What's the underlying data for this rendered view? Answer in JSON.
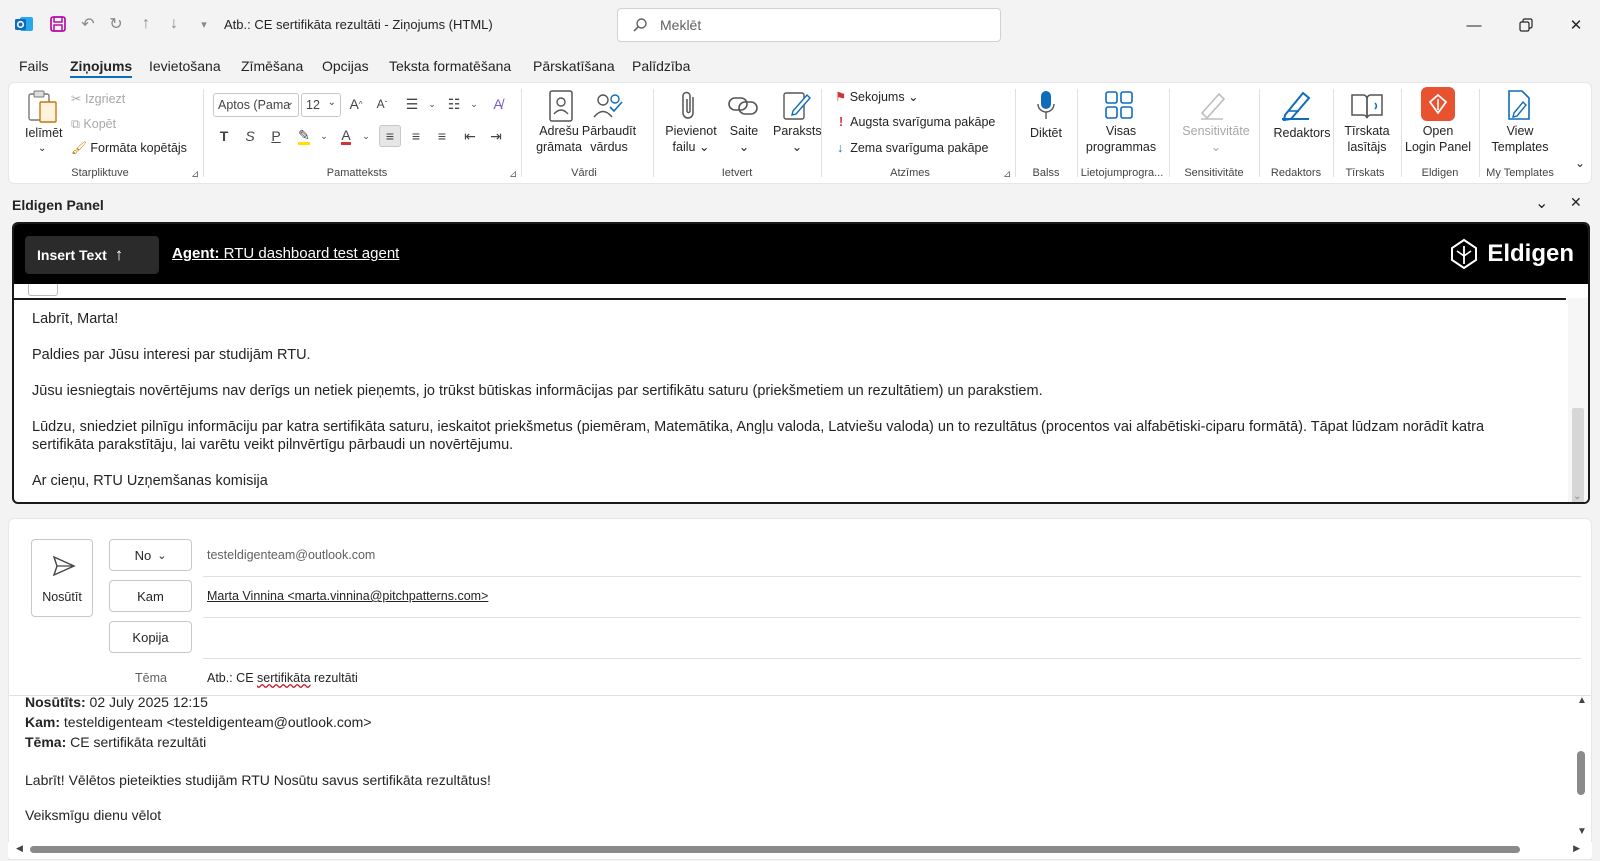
{
  "window": {
    "title": "Atb.: CE sertifikāta rezultāti  -  Ziņojums (HTML)",
    "search_placeholder": "Meklēt"
  },
  "menu": [
    "Fails",
    "Ziņojums",
    "Ievietošana",
    "Zīmēšana",
    "Opcijas",
    "Teksta formatēšana",
    "Pārskatīšana",
    "Palīdzība"
  ],
  "ribbon": {
    "clipboard": {
      "paste": "Ielīmēt",
      "cut": "Izgriezt",
      "copy": "Kopēt",
      "format_painter": "Formāta kopētājs",
      "group": "Starpliktuve"
    },
    "basic_text": {
      "font": "Aptos (Pama",
      "size": "12",
      "group": "Pamatteksts"
    },
    "names": {
      "address_book_1": "Adrešu",
      "address_book_2": "grāmata",
      "check_names_1": "Pārbaudīt",
      "check_names_2": "vārdus",
      "group": "Vārdi"
    },
    "include": {
      "attach_1": "Pievienot",
      "attach_2": "failu",
      "link": "Saite",
      "signature": "Paraksts",
      "group": "Ietvert"
    },
    "tags": {
      "follow_up": "Sekojums",
      "high": "Augsta svarīguma pakāpe",
      "low": "Zema svarīguma pakāpe",
      "group": "Atzīmes"
    },
    "voice": {
      "dictate": "Diktēt",
      "group": "Balss"
    },
    "apps": {
      "label_1": "Visas",
      "label_2": "programmas",
      "group": "Lietojumprogra..."
    },
    "sensitivity": {
      "label": "Sensitivitāte",
      "group": "Sensitivitāte"
    },
    "editor": {
      "label": "Redaktors",
      "group": "Redaktors"
    },
    "reader": {
      "label_1": "Tīrskata",
      "label_2": "lasītājs",
      "group": "Tīrskats"
    },
    "eldigen": {
      "label_1": "Open",
      "label_2": "Login Panel",
      "group": "Eldigen"
    },
    "templates": {
      "label_1": "View",
      "label_2": "Templates",
      "group": "My Templates"
    }
  },
  "panel": {
    "title": "Eldigen Panel",
    "insert_button": "Insert Text",
    "agent_prefix": "Agent:",
    "agent_name": "RTU dashboard test agent",
    "brand": "Eldigen",
    "draft": [
      "Labrīt, Marta!",
      "Paldies par Jūsu interesi par studijām RTU.",
      "Jūsu iesniegtais novērtējums nav derīgs un netiek pieņemts, jo trūkst būtiskas informācijas par sertifikātu saturu (priekšmetiem un rezultātiem) un parakstiem.",
      "Lūdzu, sniedziet pilnīgu informāciju par katra sertifikāta saturu, ieskaitot priekšmetus (piemēram, Matemātika, Angļu valoda, Latviešu valoda) un to rezultātus (procentos vai alfabētiski-ciparu formātā). Tāpat lūdzam norādīt katra sertifikāta parakstītāju, lai varētu veikt pilnvērtīgu pārbaudi un novērtējumu.",
      "Ar cieņu, RTU Uzņemšanas komisija"
    ]
  },
  "compose": {
    "send": "Nosūtīt",
    "from_label": "No",
    "from_value": "testeldigenteam@outlook.com",
    "to_label": "Kam",
    "to_value": "Marta Vinnina <marta.vinnina@pitchpatterns.com>",
    "cc_label": "Kopija",
    "subject_label": "Tēma",
    "subject_prefix": "Atb.: CE ",
    "subject_word": "sertifikāta",
    "subject_rest": " rezultāti"
  },
  "quoted": {
    "sent_label": "Nosūtīts:",
    "sent_value": " 02 July 2025 12:15",
    "to_label": "Kam:",
    "to_value": " testeldigenteam <testeldigenteam@outlook.com>",
    "subject_label": "Tēma:",
    "subject_value": " CE sertifikāta rezultāti",
    "line1": "Labrīt! Vēlētos pieteikties studijām RTU Nosūtu savus sertifikāta rezultātus!",
    "line2": "Veiksmīgu dienu vēlot"
  },
  "colors": {
    "accent": "#0f6cbd",
    "eldigen": "#e8522f",
    "agent_bar": "#000000"
  }
}
